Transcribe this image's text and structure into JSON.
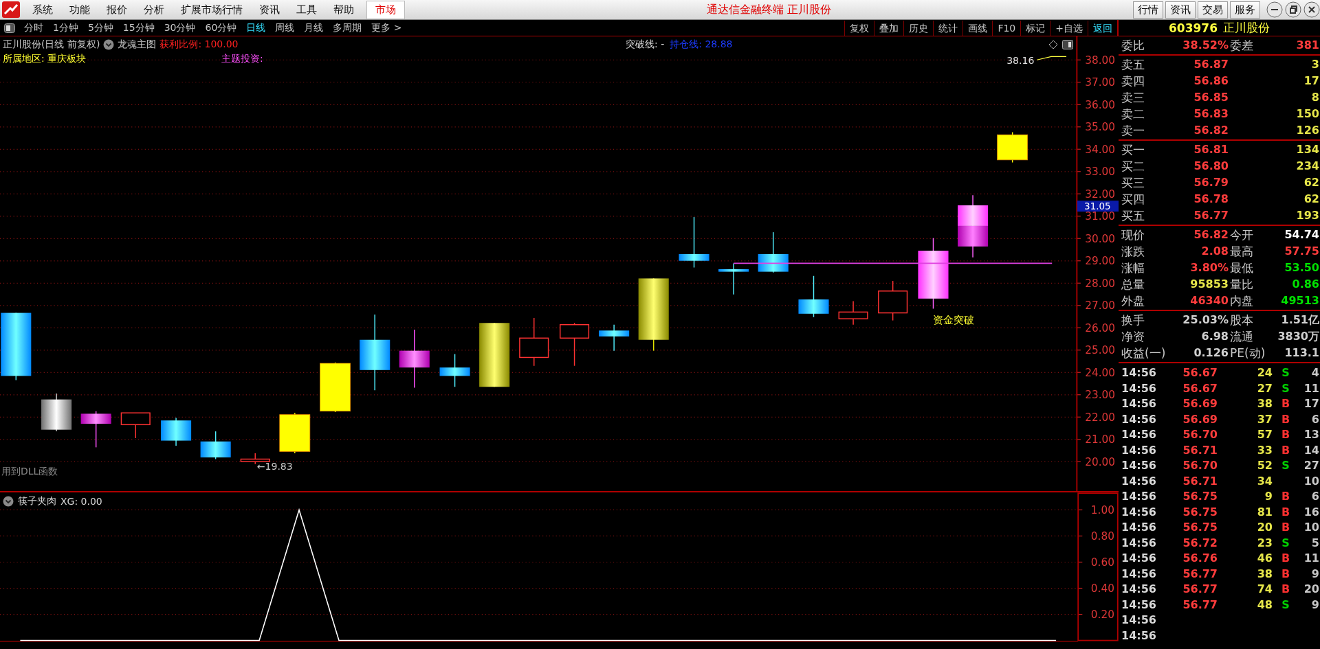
{
  "menu_bar": {
    "items": [
      "系统",
      "功能",
      "报价",
      "分析",
      "扩展市场行情",
      "资讯",
      "工具",
      "帮助"
    ],
    "market_tab": "市场",
    "title": "通达信金融终端  正川股份",
    "buttons": [
      "行情",
      "资讯",
      "交易",
      "服务"
    ]
  },
  "period_tabs": [
    {
      "label": "分时",
      "selected": false
    },
    {
      "label": "1分钟",
      "selected": false
    },
    {
      "label": "5分钟",
      "selected": false
    },
    {
      "label": "15分钟",
      "selected": false
    },
    {
      "label": "30分钟",
      "selected": false
    },
    {
      "label": "60分钟",
      "selected": false
    },
    {
      "label": "日线",
      "selected": true
    },
    {
      "label": "周线",
      "selected": false
    },
    {
      "label": "月线",
      "selected": false
    },
    {
      "label": "多周期",
      "selected": false
    },
    {
      "label": "更多 >",
      "selected": false
    }
  ],
  "chart_tools": [
    {
      "label": "复权",
      "highlighted": false
    },
    {
      "label": "叠加",
      "highlighted": false
    },
    {
      "label": "历史",
      "highlighted": false
    },
    {
      "label": "统计",
      "highlighted": false
    },
    {
      "label": "画线",
      "highlighted": false
    },
    {
      "label": "F10",
      "highlighted": false
    },
    {
      "label": "标记",
      "highlighted": false
    },
    {
      "label": "+自选",
      "highlighted": false
    },
    {
      "label": "返回",
      "highlighted": true
    }
  ],
  "price_chart": {
    "title": "正川股份(日线 前复权)",
    "indicator": "龙魂主图",
    "profit_ratio": "获利比例: 100.00",
    "breakout_line": "突破线: -",
    "position_line": "持仓线: 28.88",
    "region": "所属地区: 重庆板块",
    "theme": "主题投资:",
    "high_marker": "38.16",
    "low_marker": "←19.83",
    "signal_label": "资金突破",
    "current_price_tag": "31.05",
    "y_ticks": [
      "38.00",
      "37.00",
      "36.00",
      "35.00",
      "34.00",
      "33.00",
      "32.00",
      "31.00",
      "30.00",
      "29.00",
      "28.00",
      "27.00",
      "26.00",
      "25.00",
      "24.00",
      "23.00",
      "22.00",
      "21.00",
      "20.00"
    ],
    "footnote": "用到DLL函数"
  },
  "indicator_panel": {
    "name": "筷子夹肉",
    "value": "XG: 0.00",
    "chart_data": {
      "type": "line",
      "grid": true,
      "ylim": [
        0,
        1
      ],
      "yticks": [
        {
          "value": 1,
          "label": "1.00"
        },
        {
          "value": 0.8,
          "label": "0.80"
        },
        {
          "value": 0.6,
          "label": "0.60"
        },
        {
          "value": 0.4,
          "label": "0.40"
        },
        {
          "value": 0.2,
          "label": "0.20"
        }
      ],
      "series": [
        {
          "color": "#ffffff",
          "values": [
            0,
            0,
            0,
            0,
            0,
            0,
            0,
            1,
            0,
            0,
            0,
            0,
            0,
            0,
            0,
            0,
            0,
            0,
            0,
            0,
            0,
            0,
            0,
            0,
            0,
            0,
            0
          ]
        }
      ]
    }
  },
  "quote_panel": {
    "code": "603976",
    "name": "正川股份",
    "ratio": {
      "label": "委比",
      "value": "38.52%",
      "label2": "委差",
      "value2": "381"
    },
    "asks": [
      {
        "label": "卖五",
        "price": "56.87",
        "volume": "3"
      },
      {
        "label": "卖四",
        "price": "56.86",
        "volume": "17"
      },
      {
        "label": "卖三",
        "price": "56.85",
        "volume": "8"
      },
      {
        "label": "卖二",
        "price": "56.83",
        "volume": "150"
      },
      {
        "label": "卖一",
        "price": "56.82",
        "volume": "126"
      }
    ],
    "bids": [
      {
        "label": "买一",
        "price": "56.81",
        "volume": "134"
      },
      {
        "label": "买二",
        "price": "56.80",
        "volume": "234"
      },
      {
        "label": "买三",
        "price": "56.79",
        "volume": "62"
      },
      {
        "label": "买四",
        "price": "56.78",
        "volume": "62"
      },
      {
        "label": "买五",
        "price": "56.77",
        "volume": "193"
      }
    ],
    "stats": [
      {
        "cells": [
          {
            "label": "现价",
            "value": "56.82",
            "color": "#ff3c3c"
          },
          {
            "label": "今开",
            "value": "54.74",
            "color": "#ffffff"
          }
        ]
      },
      {
        "cells": [
          {
            "label": "涨跌",
            "value": "2.08",
            "color": "#ff3c3c"
          },
          {
            "label": "最高",
            "value": "57.75",
            "color": "#ff3c3c"
          }
        ]
      },
      {
        "cells": [
          {
            "label": "涨幅",
            "value": "3.80%",
            "color": "#ff3c3c"
          },
          {
            "label": "最低",
            "value": "53.50",
            "color": "#00e000"
          }
        ]
      },
      {
        "cells": [
          {
            "label": "总量",
            "value": "95853",
            "color": "#e6e64a"
          },
          {
            "label": "量比",
            "value": "0.86",
            "color": "#00e000"
          }
        ]
      },
      {
        "cells": [
          {
            "label": "外盘",
            "value": "46340",
            "color": "#ff3c3c"
          },
          {
            "label": "内盘",
            "value": "49513",
            "color": "#00e000"
          }
        ]
      }
    ],
    "fundamentals": [
      {
        "label": "换手",
        "value": "25.03%",
        "label2": "股本",
        "value2": "1.51亿"
      },
      {
        "label": "净资",
        "value": "6.98",
        "label2": "流通",
        "value2": "3830万"
      },
      {
        "label": "收益(一)",
        "value": "0.126",
        "label2": "PE(动)",
        "value2": "113.1"
      }
    ],
    "trades": [
      {
        "time": "14:56",
        "price": "56.67",
        "volume": "24",
        "side": "S",
        "color": "#00d000",
        "count": "4"
      },
      {
        "time": "14:56",
        "price": "56.67",
        "volume": "27",
        "side": "S",
        "color": "#00d000",
        "count": "11"
      },
      {
        "time": "14:56",
        "price": "56.69",
        "volume": "38",
        "side": "B",
        "color": "#ff3030",
        "count": "17"
      },
      {
        "time": "14:56",
        "price": "56.69",
        "volume": "37",
        "side": "B",
        "color": "#ff3030",
        "count": "6"
      },
      {
        "time": "14:56",
        "price": "56.70",
        "volume": "57",
        "side": "B",
        "color": "#ff3030",
        "count": "13"
      },
      {
        "time": "14:56",
        "price": "56.71",
        "volume": "33",
        "side": "B",
        "color": "#ff3030",
        "count": "14"
      },
      {
        "time": "14:56",
        "price": "56.70",
        "volume": "52",
        "side": "S",
        "color": "#00d000",
        "count": "27"
      },
      {
        "time": "14:56",
        "price": "56.71",
        "volume": "34",
        "count": "10"
      },
      {
        "time": "14:56",
        "price": "56.75",
        "volume": "9",
        "side": "B",
        "color": "#ff3030",
        "count": "6"
      },
      {
        "time": "14:56",
        "price": "56.75",
        "volume": "81",
        "side": "B",
        "color": "#ff3030",
        "count": "16"
      },
      {
        "time": "14:56",
        "price": "56.75",
        "volume": "20",
        "side": "B",
        "color": "#ff3030",
        "count": "10"
      },
      {
        "time": "14:56",
        "price": "56.72",
        "volume": "23",
        "side": "S",
        "color": "#00d000",
        "count": "5"
      },
      {
        "time": "14:56",
        "price": "56.76",
        "volume": "46",
        "side": "B",
        "color": "#ff3030",
        "count": "11"
      },
      {
        "time": "14:56",
        "price": "56.77",
        "volume": "38",
        "side": "B",
        "color": "#ff3030",
        "count": "9"
      },
      {
        "time": "14:56",
        "price": "56.77",
        "volume": "74",
        "side": "B",
        "color": "#ff3030",
        "count": "20"
      },
      {
        "time": "14:56",
        "price": "56.77",
        "volume": "48",
        "side": "S",
        "color": "#00d000",
        "count": "9"
      },
      {
        "time": "14:56"
      },
      {
        "time": "14:56"
      }
    ]
  }
}
